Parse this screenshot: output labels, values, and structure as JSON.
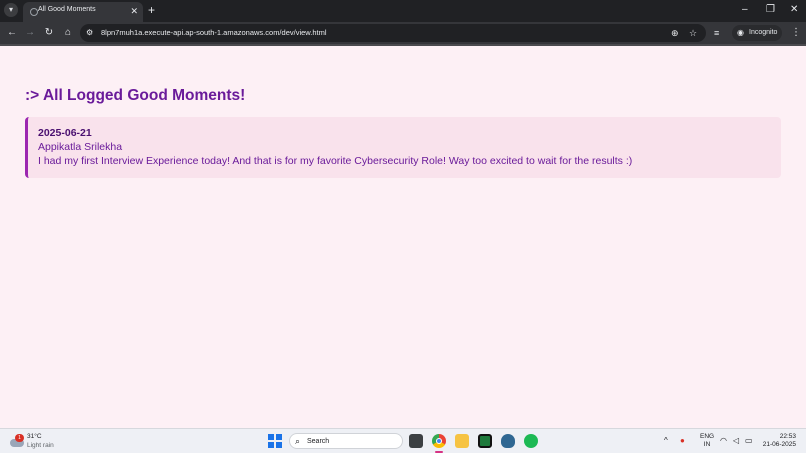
{
  "browser": {
    "tab_menu_icon": "chevron-down-icon",
    "tab_title": "All Good Moments",
    "url": "8lpn7muh1a.execute-api.ap-south-1.amazonaws.com/dev/view.html",
    "incognito_label": "Incognito"
  },
  "page": {
    "heading": ":> All Logged Good Moments!",
    "entries": [
      {
        "date": "2025-06-21",
        "name": "Appikatla Srilekha",
        "text": "I had my first Interview Experience today! And that is for my favorite Cybersecurity Role! Way too excited to wait for the results :)"
      }
    ]
  },
  "taskbar": {
    "weather_badge": "1",
    "weather_temp": "31°C",
    "weather_desc": "Light rain",
    "search_label": "Search",
    "lang_line1": "ENG",
    "lang_line2": "IN",
    "time": "22:53",
    "date": "21-06-2025"
  },
  "colors": {
    "heading": "#6a1b9a",
    "card_bg": "#f9e2ec",
    "card_border": "#9c27b0",
    "page_bg": "#fdf0f5"
  }
}
